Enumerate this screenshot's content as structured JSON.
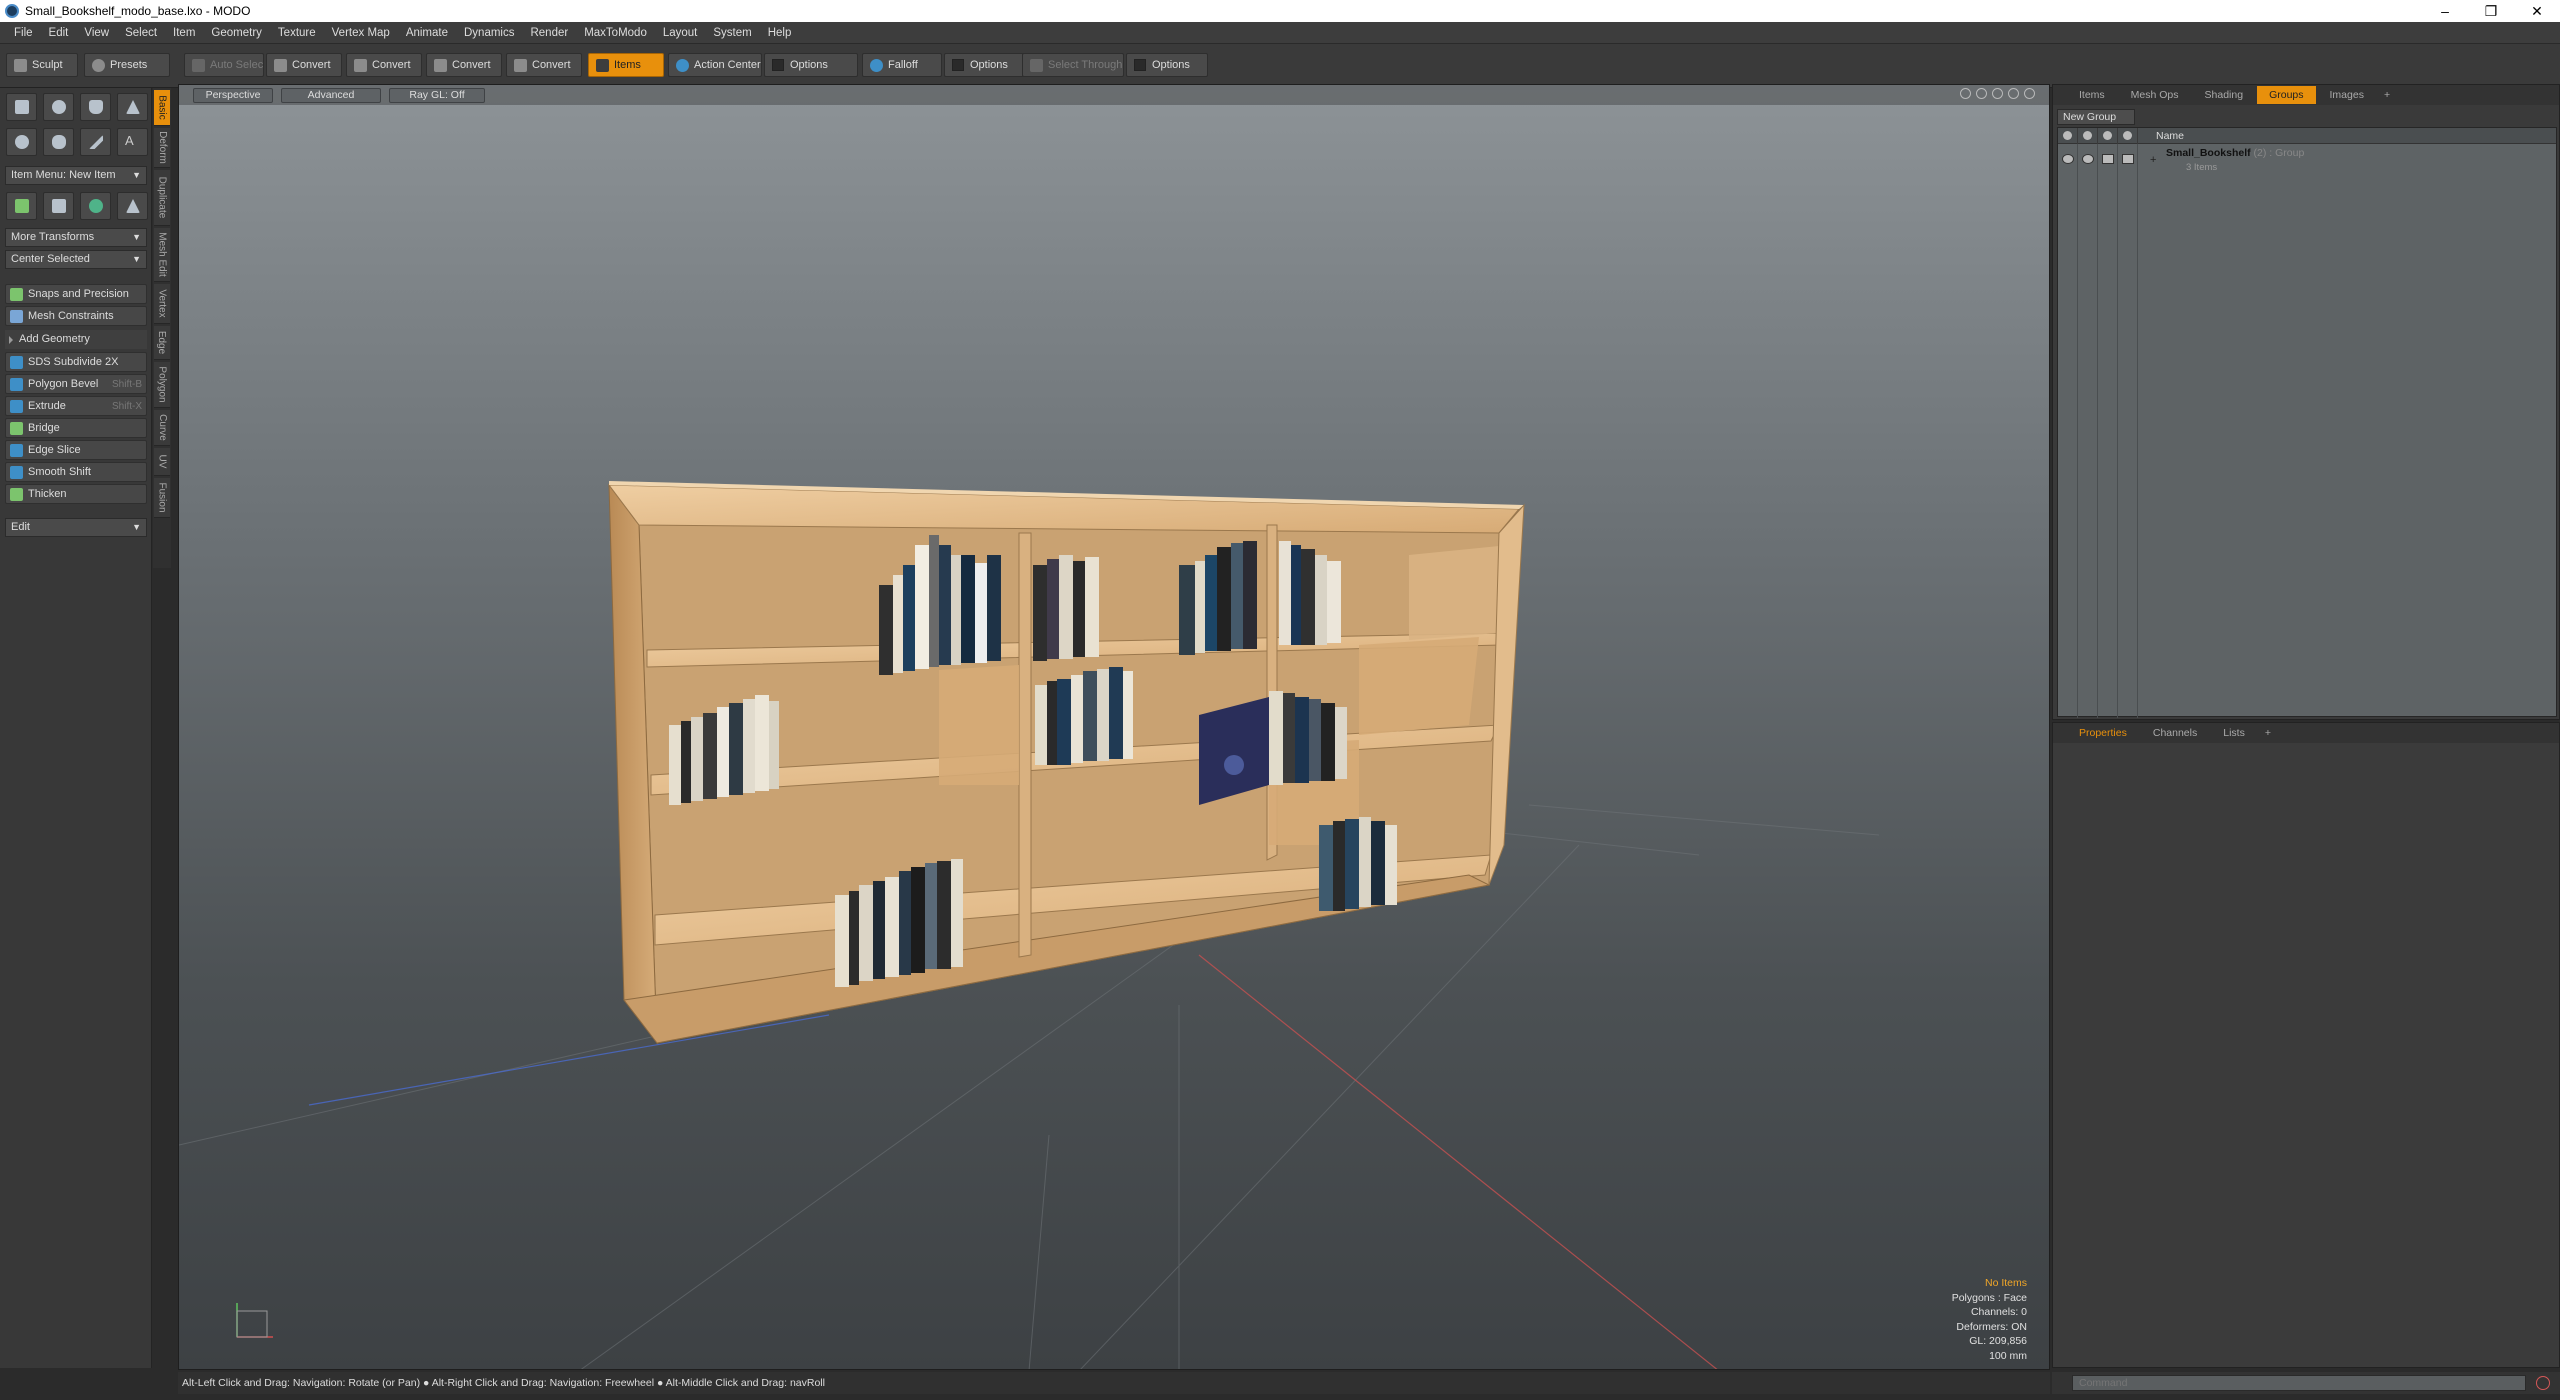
{
  "window": {
    "title": "Small_Bookshelf_modo_base.lxo - MODO"
  },
  "menu": [
    "File",
    "Edit",
    "View",
    "Select",
    "Item",
    "Geometry",
    "Texture",
    "Vertex Map",
    "Animate",
    "Dynamics",
    "Render",
    "MaxToModo",
    "Layout",
    "System",
    "Help"
  ],
  "toolbar": {
    "sculpt": "Sculpt",
    "presets": "Presets",
    "auto_select": "Auto Select",
    "convert_1": "Convert",
    "convert_2": "Convert",
    "convert_3": "Convert",
    "convert_4": "Convert",
    "items": "Items",
    "action_center": "Action Center",
    "options_1": "Options",
    "falloff": "Falloff",
    "options_2": "Options",
    "select_through": "Select Through",
    "options_3": "Options"
  },
  "toolbox": {
    "item_menu": "Item Menu: New Item",
    "more_transforms": "More Transforms",
    "center_selected": "Center Selected",
    "snaps": "Snaps and Precision",
    "mesh_constraints": "Mesh Constraints",
    "add_geometry": "Add Geometry",
    "tools": [
      {
        "label": "SDS Subdivide 2X",
        "shortcut": ""
      },
      {
        "label": "Polygon Bevel",
        "shortcut": "Shift-B"
      },
      {
        "label": "Extrude",
        "shortcut": "Shift-X"
      },
      {
        "label": "Bridge",
        "shortcut": ""
      },
      {
        "label": "Edge Slice",
        "shortcut": ""
      },
      {
        "label": "Smooth Shift",
        "shortcut": ""
      },
      {
        "label": "Thicken",
        "shortcut": ""
      }
    ],
    "edit": "Edit"
  },
  "sidetabs": [
    "Basic",
    "Deform",
    "Duplicate",
    "Mesh Edit",
    "Vertex",
    "Edge",
    "Polygon",
    "Curve",
    "UV",
    "Fusion"
  ],
  "viewport": {
    "view_mode": "Perspective",
    "advanced": "Advanced",
    "raygl": "Ray GL: Off",
    "info": {
      "items": "No Items",
      "polygons": "Polygons : Face",
      "channels": "Channels: 0",
      "deformers": "Deformers: ON",
      "gl": "GL: 209,856",
      "unit": "100 mm"
    }
  },
  "statusbar": "Alt-Left Click and Drag: Navigation: Rotate (or Pan) ● Alt-Right Click and Drag: Navigation: Freewheel ● Alt-Middle Click and Drag: navRoll",
  "right_top": {
    "tabs": [
      "Items",
      "Mesh Ops",
      "Shading",
      "Groups",
      "Images",
      "+"
    ],
    "new_group": "New Group",
    "name_header": "Name",
    "group_name": "Small_Bookshelf",
    "group_type": "(2) : Group",
    "group_count": "3 Items"
  },
  "right_bottom": {
    "tabs": [
      "Properties",
      "Channels",
      "Lists",
      "+"
    ]
  },
  "command": {
    "placeholder": "Command"
  },
  "colors": {
    "accent": "#e8900c",
    "viewport_top": "#8d9397",
    "viewport_bottom": "#3d4144",
    "wood": "#e2b987"
  }
}
